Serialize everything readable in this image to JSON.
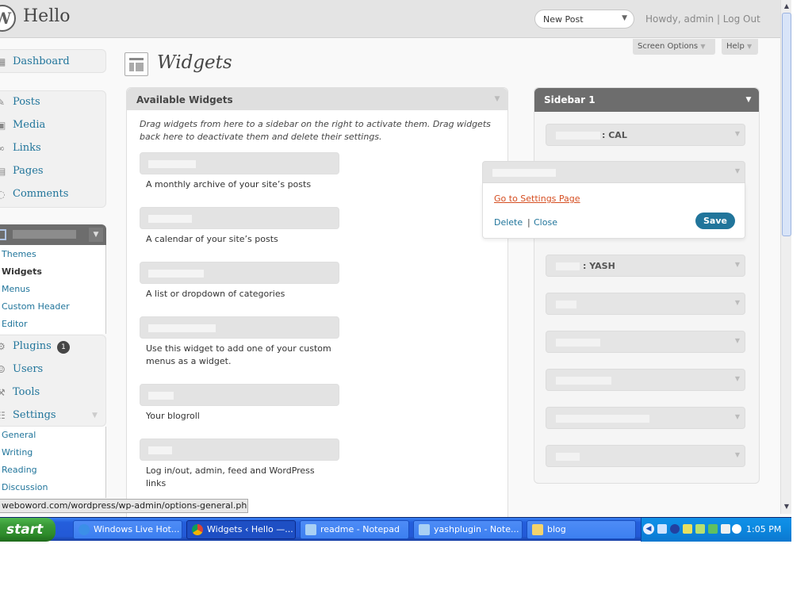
{
  "header": {
    "site_title": "Hello",
    "favorite_action": "New Post",
    "user_greeting": "Howdy, admin | Log Out",
    "screen_options": "Screen Options",
    "help": "Help"
  },
  "menu": {
    "dashboard": "Dashboard",
    "posts": "Posts",
    "media": "Media",
    "links": "Links",
    "pages": "Pages",
    "comments": "Comments",
    "appearance_submenu": [
      "Themes",
      "Widgets",
      "Menus",
      "Custom Header",
      "Editor"
    ],
    "plugins": "Plugins",
    "plugins_update_count": "1",
    "users": "Users",
    "tools": "Tools",
    "settings": "Settings",
    "settings_submenu": [
      "General",
      "Writing",
      "Reading",
      "Discussion"
    ]
  },
  "page": {
    "title": "Widgets"
  },
  "available_widgets": {
    "title": "Available Widgets",
    "description": "Drag widgets from here to a sidebar on the right to activate them. Drag widgets back here to deactivate them and delete their settings.",
    "widgets": [
      {
        "name": "",
        "description": "A monthly archive of your site’s posts"
      },
      {
        "name": "",
        "description": "A calendar of your site’s posts"
      },
      {
        "name": "",
        "description": "A list or dropdown of categories"
      },
      {
        "name": "",
        "description": "Use this widget to add one of your custom menus as a widget."
      },
      {
        "name": "",
        "description": "Your blogroll"
      },
      {
        "name": "",
        "description": "Log in/out, admin, feed and WordPress links"
      }
    ]
  },
  "sidebar": {
    "title": "Sidebar 1",
    "widgets": [
      {
        "name": "",
        "instance_title": ": CAL"
      },
      {
        "name": "",
        "instance_title": ": YASH"
      },
      {
        "name": "",
        "instance_title": ""
      },
      {
        "name": "",
        "instance_title": ""
      },
      {
        "name": "",
        "instance_title": ""
      },
      {
        "name": "",
        "instance_title": ""
      },
      {
        "name": "",
        "instance_title": ""
      }
    ]
  },
  "expanded_widget": {
    "settings_link": "Go to Settings Page",
    "delete": "Delete",
    "separator": "|",
    "close": "Close",
    "save": "Save"
  },
  "status_bar": {
    "url": "weboword.com/wordpress/wp-admin/options-general.php?pa..."
  },
  "taskbar": {
    "start": "start",
    "windows": [
      {
        "label": "Windows Live Hot...",
        "icon": "ie-icon"
      },
      {
        "label": "Widgets ‹ Hello —...",
        "icon": "chrome-icon"
      },
      {
        "label": "readme - Notepad",
        "icon": "notepad-icon"
      },
      {
        "label": "yashplugin - Note...",
        "icon": "notepad-icon"
      },
      {
        "label": "blog",
        "icon": "folder-icon"
      }
    ],
    "clock": "1:05 PM"
  },
  "colors": {
    "link": "#21759b",
    "highlight_link": "#d54e21",
    "menu_current_bg": "#6d6d6d",
    "taskbar_blue": "#245edc",
    "start_green": "#3a9a38"
  }
}
